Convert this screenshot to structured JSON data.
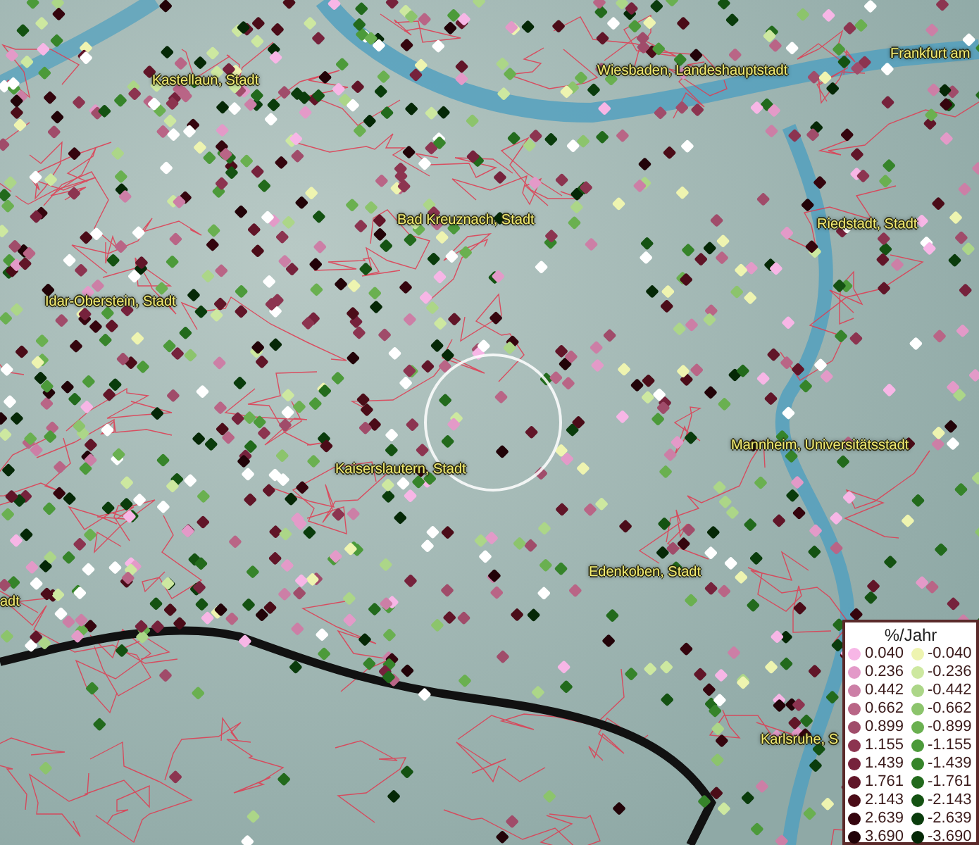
{
  "map": {
    "places": [
      {
        "name": "Kastellaun, Stadt"
      },
      {
        "name": "Wiesbaden, Landeshauptstadt"
      },
      {
        "name": "Frankfurt am"
      },
      {
        "name": "Bad Kreuznach, Stadt"
      },
      {
        "name": "Riedstadt, Stadt"
      },
      {
        "name": "Idar-Oberstein, Stadt"
      },
      {
        "name": "Kaiserslautern, Stadt"
      },
      {
        "name": "Mannheim, Universitätsstadt"
      },
      {
        "name": "adt"
      },
      {
        "name": "Edenkoben, Stadt"
      },
      {
        "name": "Karlsruhe, S"
      }
    ]
  },
  "legend": {
    "title": "%/Jahr",
    "items": [
      {
        "label": "0.040",
        "color": "#f7b6e6"
      },
      {
        "label": "-0.040",
        "color": "#eef4b0"
      },
      {
        "label": "0.236",
        "color": "#e39ac8"
      },
      {
        "label": "-0.236",
        "color": "#cde8a0"
      },
      {
        "label": "0.442",
        "color": "#cc7fa6"
      },
      {
        "label": "-0.442",
        "color": "#acd688"
      },
      {
        "label": "0.662",
        "color": "#b96586"
      },
      {
        "label": "-0.662",
        "color": "#8cc46c"
      },
      {
        "label": "0.899",
        "color": "#a04c6a"
      },
      {
        "label": "-0.899",
        "color": "#6ab050"
      },
      {
        "label": "1.155",
        "color": "#8c3450"
      },
      {
        "label": "-1.155",
        "color": "#4c9a3a"
      },
      {
        "label": "1.439",
        "color": "#76223c"
      },
      {
        "label": "-1.439",
        "color": "#36842a"
      },
      {
        "label": "1.761",
        "color": "#611528"
      },
      {
        "label": "-1.761",
        "color": "#226a1c"
      },
      {
        "label": "2.143",
        "color": "#4b0c18"
      },
      {
        "label": "-2.143",
        "color": "#145212"
      },
      {
        "label": "2.639",
        "color": "#35050e"
      },
      {
        "label": "-2.639",
        "color": "#0a3c0c"
      },
      {
        "label": "3.690",
        "color": "#220308"
      },
      {
        "label": "-3.690",
        "color": "#052806"
      }
    ]
  }
}
